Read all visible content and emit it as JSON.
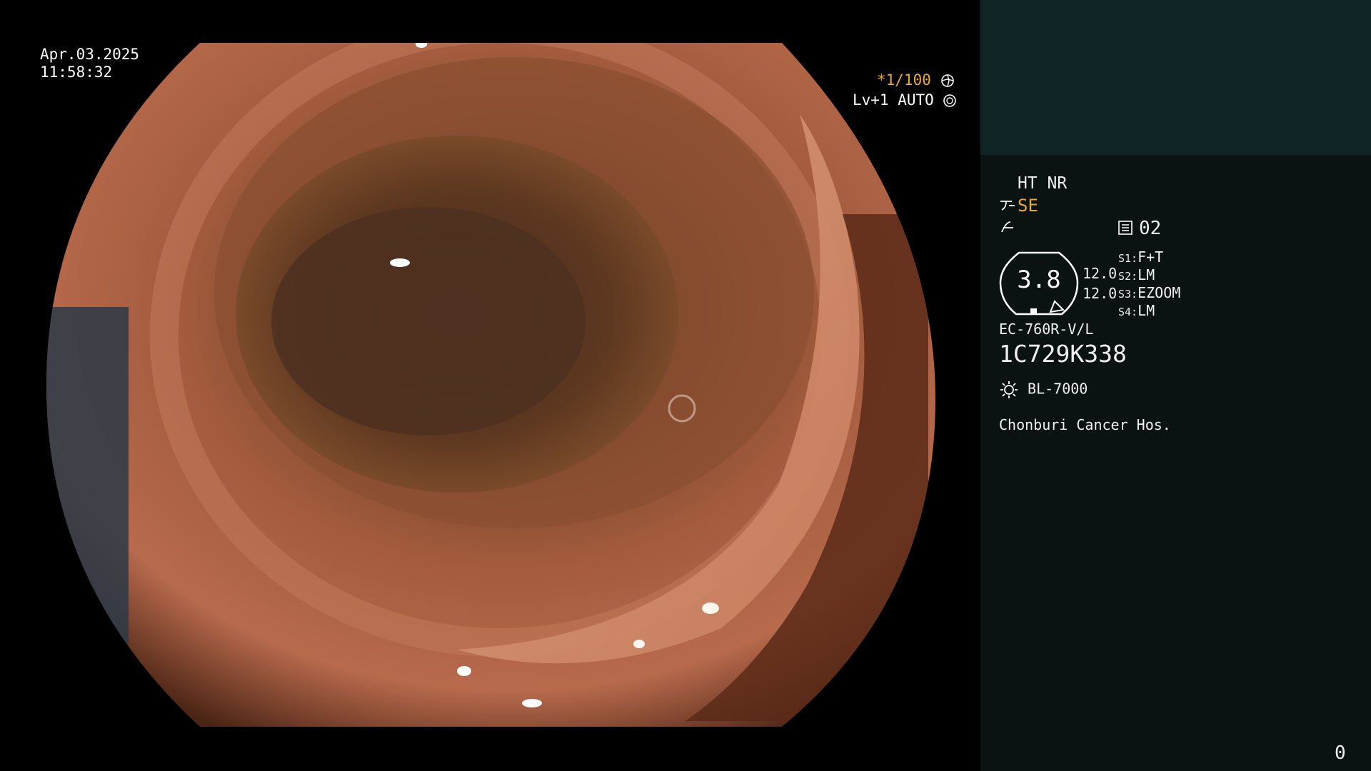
{
  "overlay": {
    "date": "Apr.03.2025",
    "time": "11:58:32",
    "shutter": "*1/100",
    "iris": "Lv+1 AUTO"
  },
  "panel": {
    "ht_nr": "HT NR",
    "enhancement": "SE",
    "page_number": "02",
    "zoom_value": "3.8",
    "zoom_max_top": "12.0",
    "zoom_max_bottom": "12.0",
    "switches": [
      {
        "label": "S1:",
        "value": "F+T"
      },
      {
        "label": "S2:",
        "value": "LM"
      },
      {
        "label": "S3:",
        "value": "EZOOM"
      },
      {
        "label": "S4:",
        "value": "LM"
      }
    ],
    "scope_model": "EC-760R-V/L",
    "serial": "1C729K338",
    "light_source": "BL-7000",
    "hospital": "Chonburi Cancer Hos.",
    "counter": "0"
  },
  "colors": {
    "accent_amber": "#e8a83a",
    "panel_top": "#0f2424",
    "panel_bottom": "#0a1212"
  },
  "icons": [
    "shutter-icon",
    "iris-icon",
    "gamma-icon",
    "structure-icon",
    "page-icon",
    "lamp-icon"
  ]
}
